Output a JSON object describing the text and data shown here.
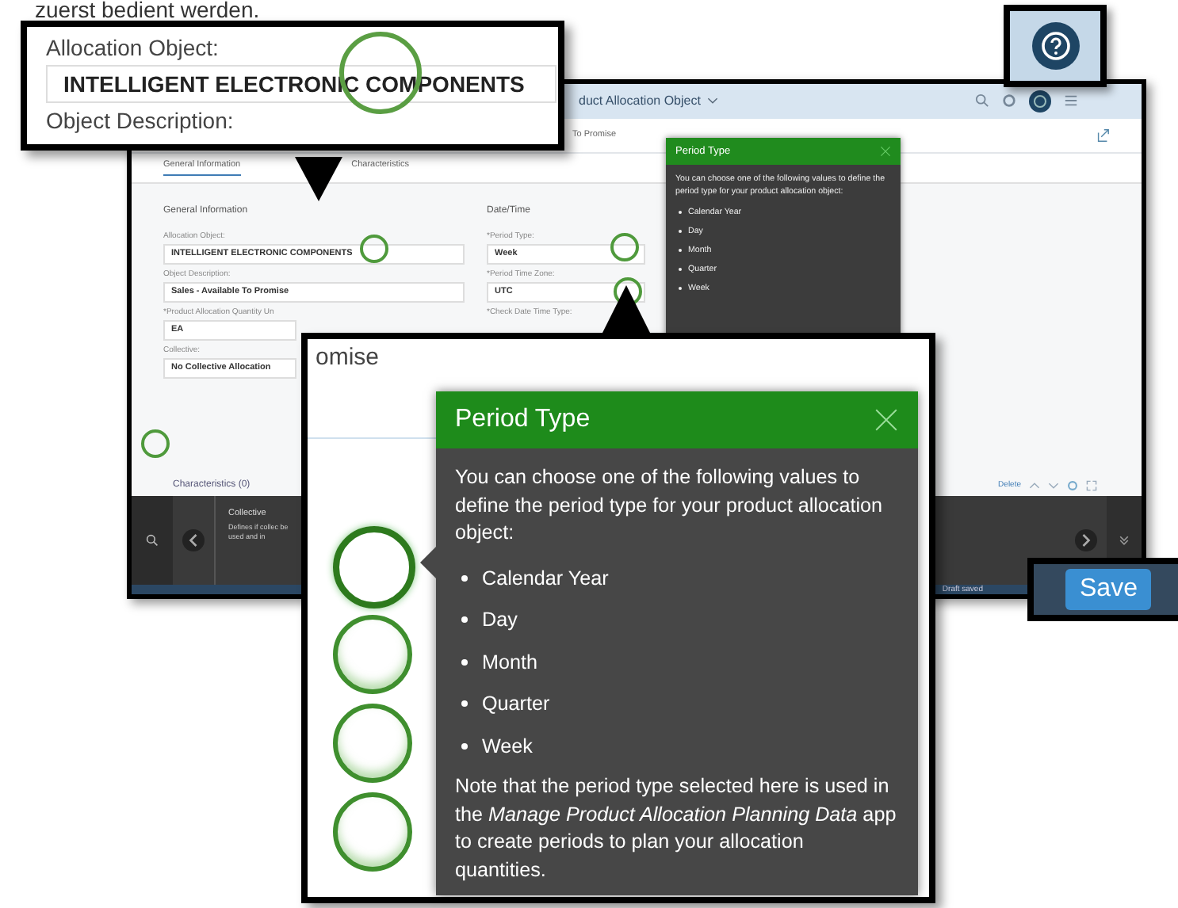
{
  "caption": "zuerst bedient werden.",
  "app": {
    "header_title": "duct Allocation Object",
    "subtitle": "To Promise",
    "tabs": [
      {
        "label": "General Information",
        "selected": true
      },
      {
        "label": "Characteristics",
        "selected": false
      }
    ],
    "sections": [
      {
        "title": "General Information",
        "fields": [
          {
            "label": "Allocation Object:",
            "value": "INTELLIGENT ELECTRONIC COMPONENTS"
          },
          {
            "label": "Object Description:",
            "value": "Sales - Available To Promise"
          },
          {
            "label": "*Product Allocation Quantity Un",
            "value": "EA"
          },
          {
            "label": "Collective:",
            "value": "No Collective Allocation"
          }
        ]
      },
      {
        "title": "Date/Time",
        "fields": [
          {
            "label": "*Period Type:",
            "value": "Week"
          },
          {
            "label": "*Period Time Zone:",
            "value": "UTC"
          },
          {
            "label": "*Check Date Time Type:"
          }
        ]
      }
    ],
    "popover": {
      "title": "Period Type",
      "intro": "You can choose one of the following values to define the period type for your product allocation object:",
      "options": [
        "Calendar Year",
        "Day",
        "Month",
        "Quarter",
        "Week"
      ]
    },
    "characteristics": "Characteristics (0)",
    "table_action": "Delete",
    "help": {
      "title": "Collective",
      "text": "Defines if collec be used and in"
    },
    "status": "Draft saved"
  },
  "callout_allocation": {
    "label": "Allocation Object:",
    "value": "INTELLIGENT ELECTRONIC COMPONENTS",
    "next_label": "Object Description:"
  },
  "callout_save": {
    "label": "Save"
  },
  "callout_popover": {
    "heading_fragment": "omise",
    "title": "Period Type",
    "intro": "You can choose one of the following values to define the period type for your product allocation object:",
    "options": [
      "Calendar Year",
      "Day",
      "Month",
      "Quarter",
      "Week"
    ],
    "note": "Note that the period type selected here is used in the *Manage Product Allocation Planning Data* app to create periods to plan your allocation quantities."
  }
}
